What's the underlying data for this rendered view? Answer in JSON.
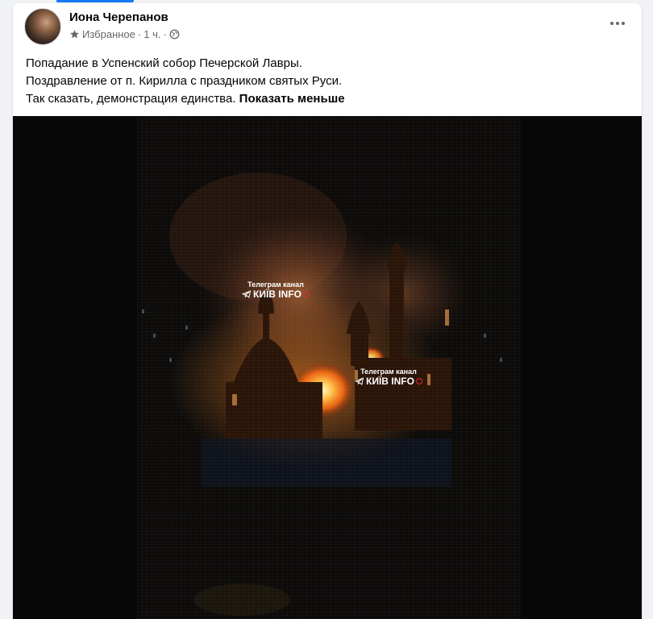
{
  "post": {
    "author": "Иона Черепанов",
    "audience": "Избранное",
    "time": "1 ч.",
    "text_lines": [
      "Попадание в Успенский собор Печерской Лавры.",
      "Поздравление от п. Кирилла с праздником святых Руси.",
      "Так сказать, демонстрация единства."
    ],
    "see_less": "Показать меньше"
  },
  "video": {
    "watermark_1": {
      "line1": "Телеграм канал",
      "line2": "КИЇВ INFO"
    },
    "watermark_2": {
      "line1": "Телеграм канал",
      "line2": "КИЇВ INFO"
    }
  },
  "icons": {
    "meta_star": "star-icon",
    "meta_globe": "globe-icon",
    "more": "more-horizontal-icon",
    "telegram": "telegram-icon"
  },
  "colors": {
    "accent": "#1877f2",
    "secondary_text": "#65676b",
    "fire": "#ff8a1c",
    "rec": "#e0302a"
  }
}
